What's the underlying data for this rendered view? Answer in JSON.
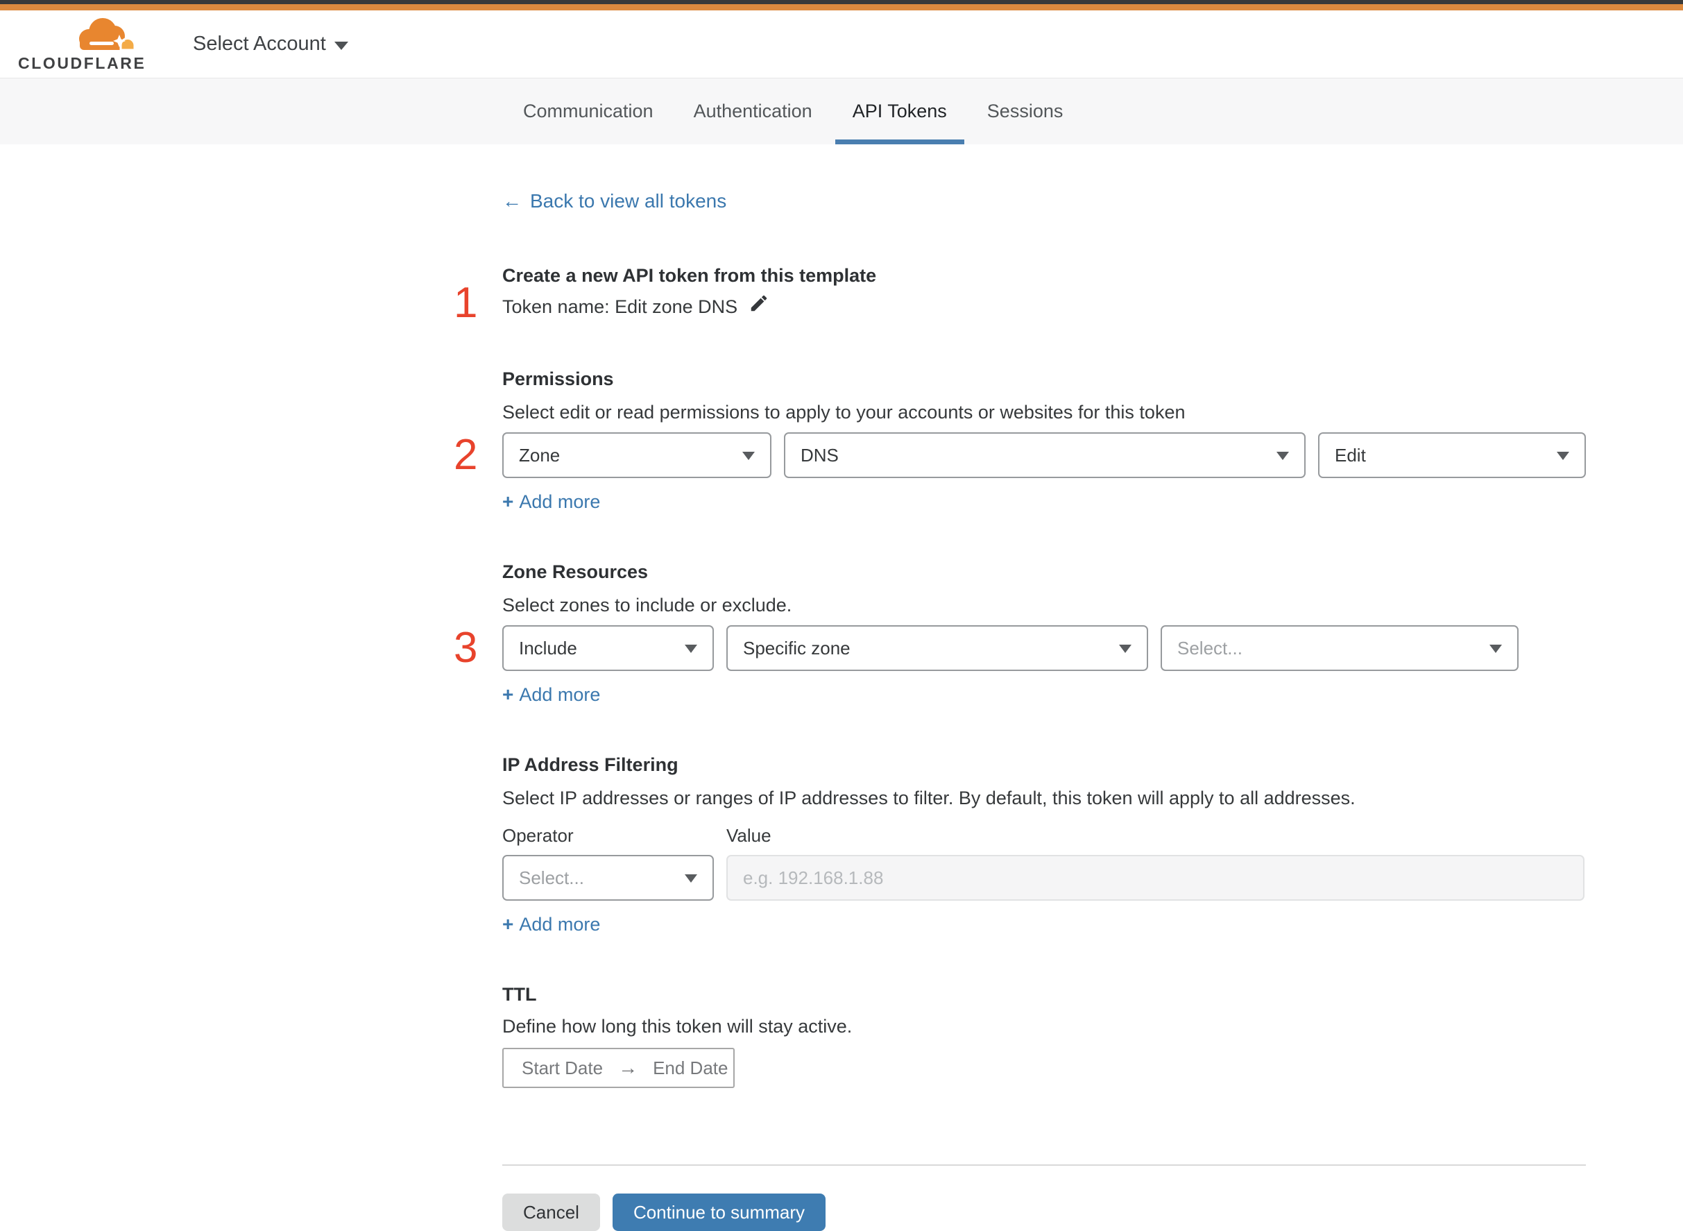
{
  "header": {
    "logo_text": "CLOUDFLARE",
    "account_selector_label": "Select Account"
  },
  "tabs": [
    {
      "label": "Communication"
    },
    {
      "label": "Authentication"
    },
    {
      "label": "API Tokens"
    },
    {
      "label": "Sessions"
    }
  ],
  "active_tab": "API Tokens",
  "back_link": {
    "arrow": "←",
    "label": "Back to view all tokens"
  },
  "labels": {
    "plus": "+",
    "add_more": "Add more"
  },
  "token": {
    "step": "1",
    "title": "Create a new API token from this template",
    "name_line": "Token name: Edit zone DNS"
  },
  "permissions": {
    "step": "2",
    "heading": "Permissions",
    "description": "Select edit or read permissions to apply to your accounts or websites for this token",
    "selects": [
      {
        "value": "Zone"
      },
      {
        "value": "DNS"
      },
      {
        "value": "Edit"
      }
    ]
  },
  "zone_resources": {
    "step": "3",
    "heading": "Zone Resources",
    "description": "Select zones to include or exclude.",
    "selects": [
      {
        "value": "Include"
      },
      {
        "value": "Specific zone"
      },
      {
        "value": "Select..."
      }
    ]
  },
  "ip_filtering": {
    "heading": "IP Address Filtering",
    "description": "Select IP addresses or ranges of IP addresses to filter. By default, this token will apply to all addresses.",
    "operator_label": "Operator",
    "value_label": "Value",
    "operator_select": "Select...",
    "value_placeholder": "e.g. 192.168.1.88"
  },
  "ttl": {
    "heading": "TTL",
    "description": "Define how long this token will stay active.",
    "start_label": "Start Date",
    "arrow": "→",
    "end_label": "End Date"
  },
  "footer": {
    "cancel_label": "Cancel",
    "continue_label": "Continue to summary"
  },
  "colors": {
    "accent_orange": "#dd8a3f",
    "step_number_red": "#e8432c",
    "link_blue": "#3b78ae",
    "primary_button_blue": "#3e7cb1",
    "active_tab_underline": "#4a7eb0"
  }
}
